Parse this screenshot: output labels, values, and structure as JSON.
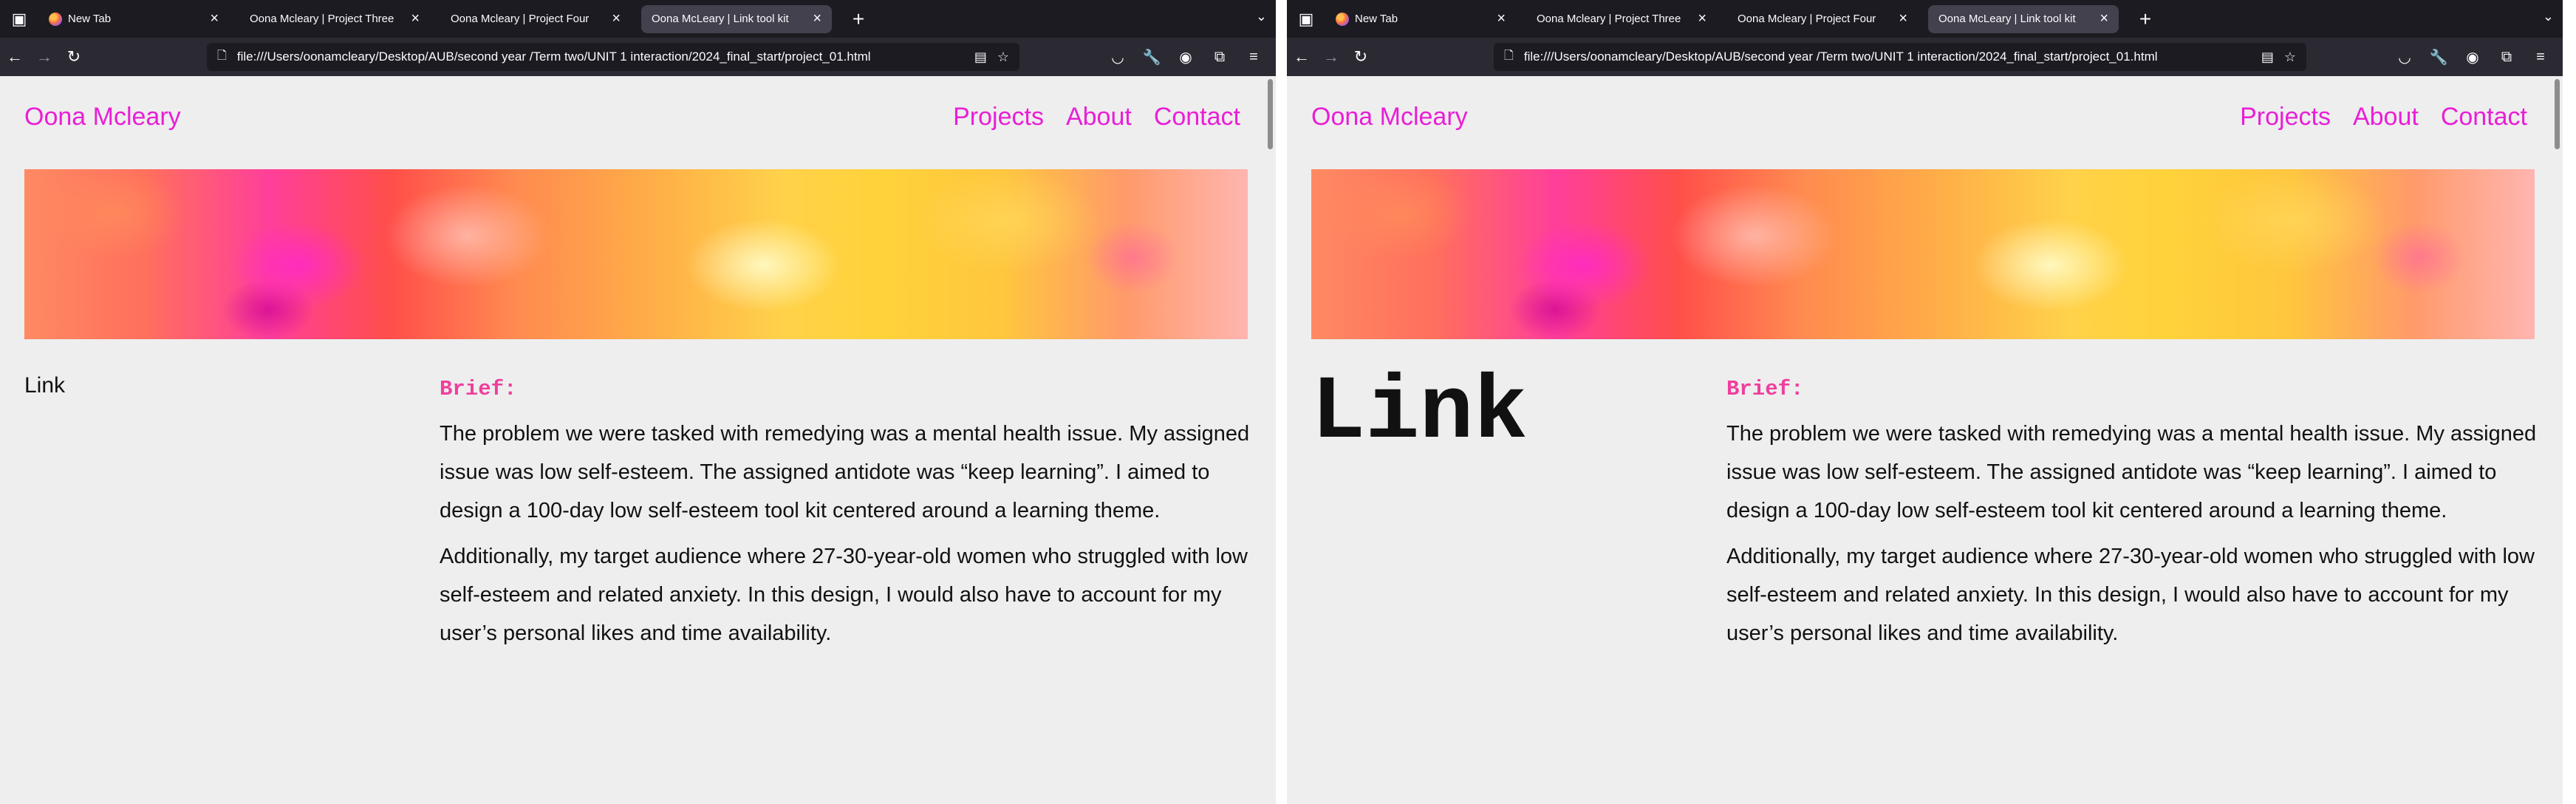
{
  "colors": {
    "accent": "#e81fd6",
    "brief_heading": "#ef3f9d",
    "tabstrip_bg": "#1c1b22",
    "navbar_bg": "#2b2a33",
    "page_bg": "#eeeeee"
  },
  "browser": {
    "tabs": [
      {
        "title": "New Tab",
        "icon": "firefox-icon"
      },
      {
        "title": "Oona Mcleary | Project Three"
      },
      {
        "title": "Oona Mcleary | Project Four"
      },
      {
        "title": "Oona McLeary | Link tool kit",
        "active": true
      }
    ],
    "url": "file:///Users/oonamcleary/Desktop/AUB/second year /Term two/UNIT 1 interaction/2024_final_start/project_01.html"
  },
  "site": {
    "name": "Oona Mcleary",
    "nav": [
      "Projects",
      "About",
      "Contact"
    ]
  },
  "project": {
    "title": "Link",
    "brief_heading": "Brief:",
    "paragraphs": [
      "The problem we were tasked with remedying was a mental health issue. My assigned issue was low self-esteem. The assigned antidote was “keep learning”. I aimed to design a 100-day low self-esteem tool kit centered around a learning theme.",
      "Additionally, my target audience where 27-30-year-old women who struggled with low self-esteem and related anxiety. In this design, I would also have to account for my user’s personal likes and time availability."
    ]
  }
}
